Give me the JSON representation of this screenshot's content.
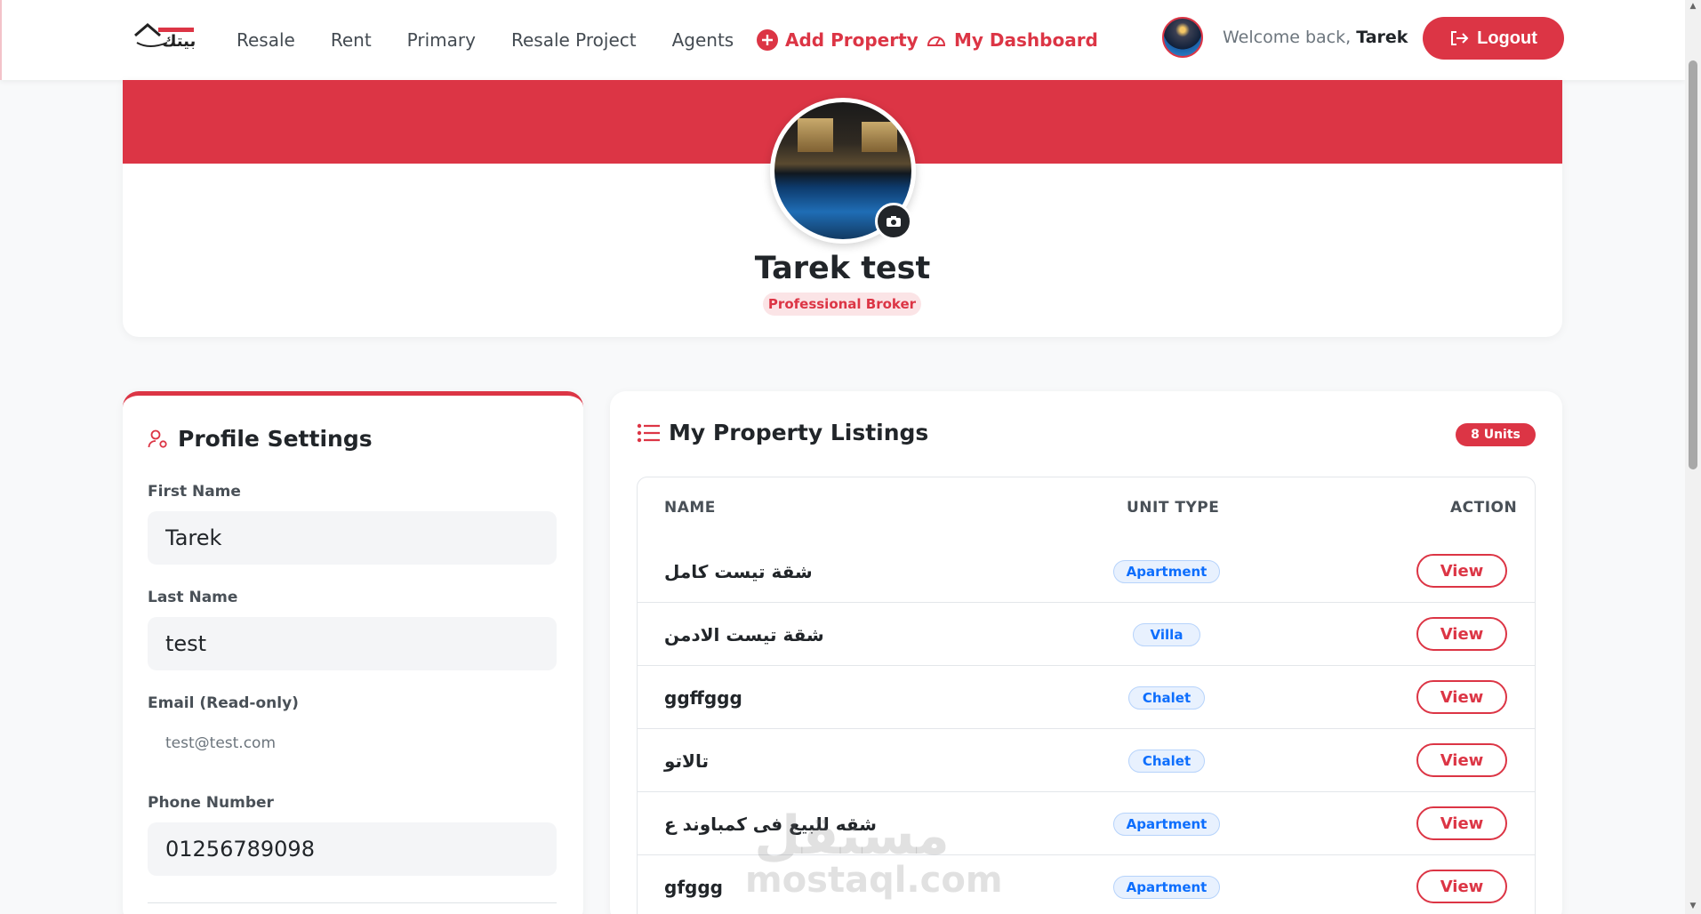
{
  "brand": {
    "logo_text": "بيتك"
  },
  "nav": {
    "links": [
      "Resale",
      "Rent",
      "Primary",
      "Resale Project",
      "Agents"
    ],
    "add_property": "Add Property",
    "dashboard": "My Dashboard"
  },
  "user": {
    "welcome_prefix": "Welcome back,",
    "first_name": "Tarek",
    "logout": "Logout"
  },
  "profile": {
    "name": "Tarek test",
    "role": "Professional Broker"
  },
  "settings": {
    "title": "Profile Settings",
    "first_name_label": "First Name",
    "first_name": "Tarek",
    "last_name_label": "Last Name",
    "last_name": "test",
    "email_label": "Email (Read-only)",
    "email": "test@test.com",
    "phone_label": "Phone Number",
    "phone": "01256789098"
  },
  "listings": {
    "title": "My Property Listings",
    "count_badge": "8 Units",
    "columns": {
      "name": "NAME",
      "unit_type": "UNIT TYPE",
      "action": "ACTION"
    },
    "rows": [
      {
        "name": "شقة تيست كامل",
        "type": "Apartment",
        "action": "View"
      },
      {
        "name": "شقة تيست الادمن",
        "type": "Villa",
        "action": "View"
      },
      {
        "name": "ggffggg",
        "type": "Chalet",
        "action": "View"
      },
      {
        "name": "تالاتو",
        "type": "Chalet",
        "action": "View"
      },
      {
        "name": "شقه للبيع فى كمباوند ع",
        "type": "Apartment",
        "action": "View"
      },
      {
        "name": "gfggg",
        "type": "Apartment",
        "action": "View"
      }
    ]
  },
  "watermark": {
    "arabic": "مستقل",
    "latin": "mostaql.com"
  },
  "colors": {
    "accent": "#dc3545",
    "badge_blue": "#0d6efd",
    "text": "#212529"
  },
  "icons": [
    "logo-house-icon",
    "plus-circle-icon",
    "speedometer-icon",
    "logout-icon",
    "camera-icon",
    "user-gear-icon",
    "list-icon"
  ]
}
